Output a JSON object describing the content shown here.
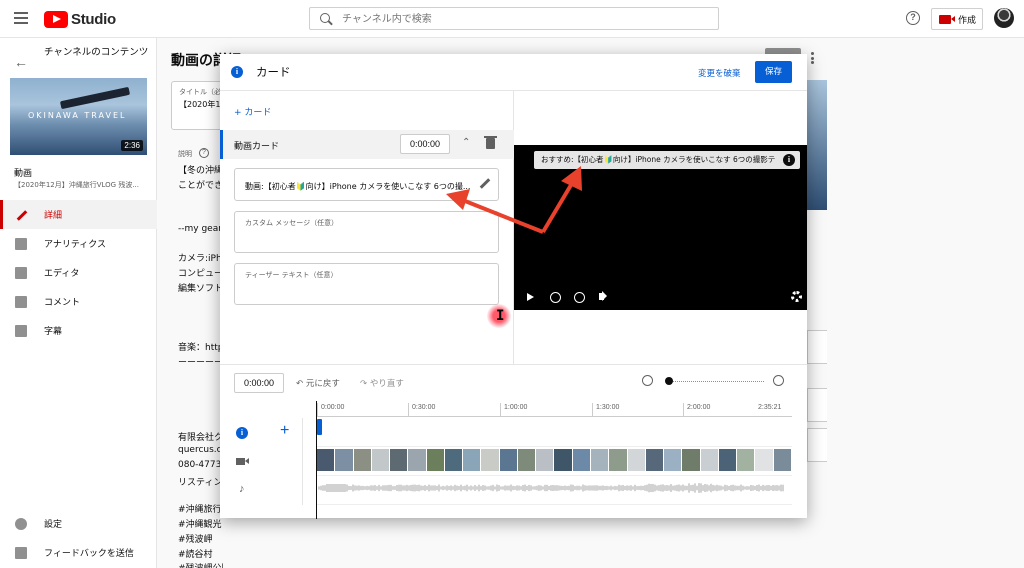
{
  "topbar": {
    "logo_text": "Studio",
    "search_placeholder": "チャンネル内で検索",
    "help_icon": "?",
    "create_label": "作成"
  },
  "sidebar": {
    "title": "チャンネルのコンテンツ",
    "thumb_brand": "OKINAWA TRAVEL",
    "thumb_duration": "2:36",
    "video_label": "動画",
    "video_sub": "【2020年12月】沖縄旅行VLOG 残波...",
    "items": [
      {
        "label": "詳細",
        "icon": "pencil-icon",
        "active": true
      },
      {
        "label": "アナリティクス",
        "icon": "analytics-icon",
        "active": false
      },
      {
        "label": "エディタ",
        "icon": "editor-icon",
        "active": false
      },
      {
        "label": "コメント",
        "icon": "comment-icon",
        "active": false
      },
      {
        "label": "字幕",
        "icon": "subtitles-icon",
        "active": false
      }
    ],
    "settings_label": "設定",
    "feedback_label": "フィードバックを送信"
  },
  "background": {
    "page_title": "動画の詳細",
    "title_field_label": "タイトル（必須）",
    "title_field_value": "【2020年12",
    "desc_label": "説明",
    "desc_help": "?",
    "desc_lines": [
      "【冬の沖縄",
      "ことができ",
      "--my gear--",
      "カメラ:iPh",
      "コンピュー",
      "編集ソフト",
      "音楽：http",
      "ーーーーー",
      "有限会社ク",
      "quercus.c",
      "080-4773-",
      "リスティン",
      "#沖縄旅行",
      "#沖縄観光",
      "#残波岬",
      "#読谷村",
      "#残波岬公園"
    ]
  },
  "modal": {
    "title": "カード",
    "discard_label": "変更を破棄",
    "save_label": "保存",
    "add_card_label": "+ カード",
    "card_row_label": "動画カード",
    "card_row_time": "0:00:00",
    "video_field_value": "動画:【初心者🔰向け】iPhone カメラを使いこなす 6つの撮...",
    "custom_message_placeholder": "カスタム メッセージ（任意）",
    "teaser_placeholder": "ティーザー テキスト（任意）",
    "preview_toast": "おすすめ:【初心者🔰向け】iPhone カメラを使いこなす 6つの撮影テ...",
    "preview_toast_icon": "i"
  },
  "timeline": {
    "current_time": "0:00:00",
    "undo_label": "元に戻す",
    "redo_label": "やり直す",
    "zoom_level": 0.0,
    "ruler_ticks": [
      "0:00:00",
      "0:30:00",
      "1:00:00",
      "1:30:00",
      "2:00:00",
      "2:35:21"
    ],
    "playhead_value": "0:00:00"
  },
  "colors": {
    "accent_blue": "#065fd4",
    "brand_red": "#cc0000",
    "annotation_red": "#e8412c"
  }
}
